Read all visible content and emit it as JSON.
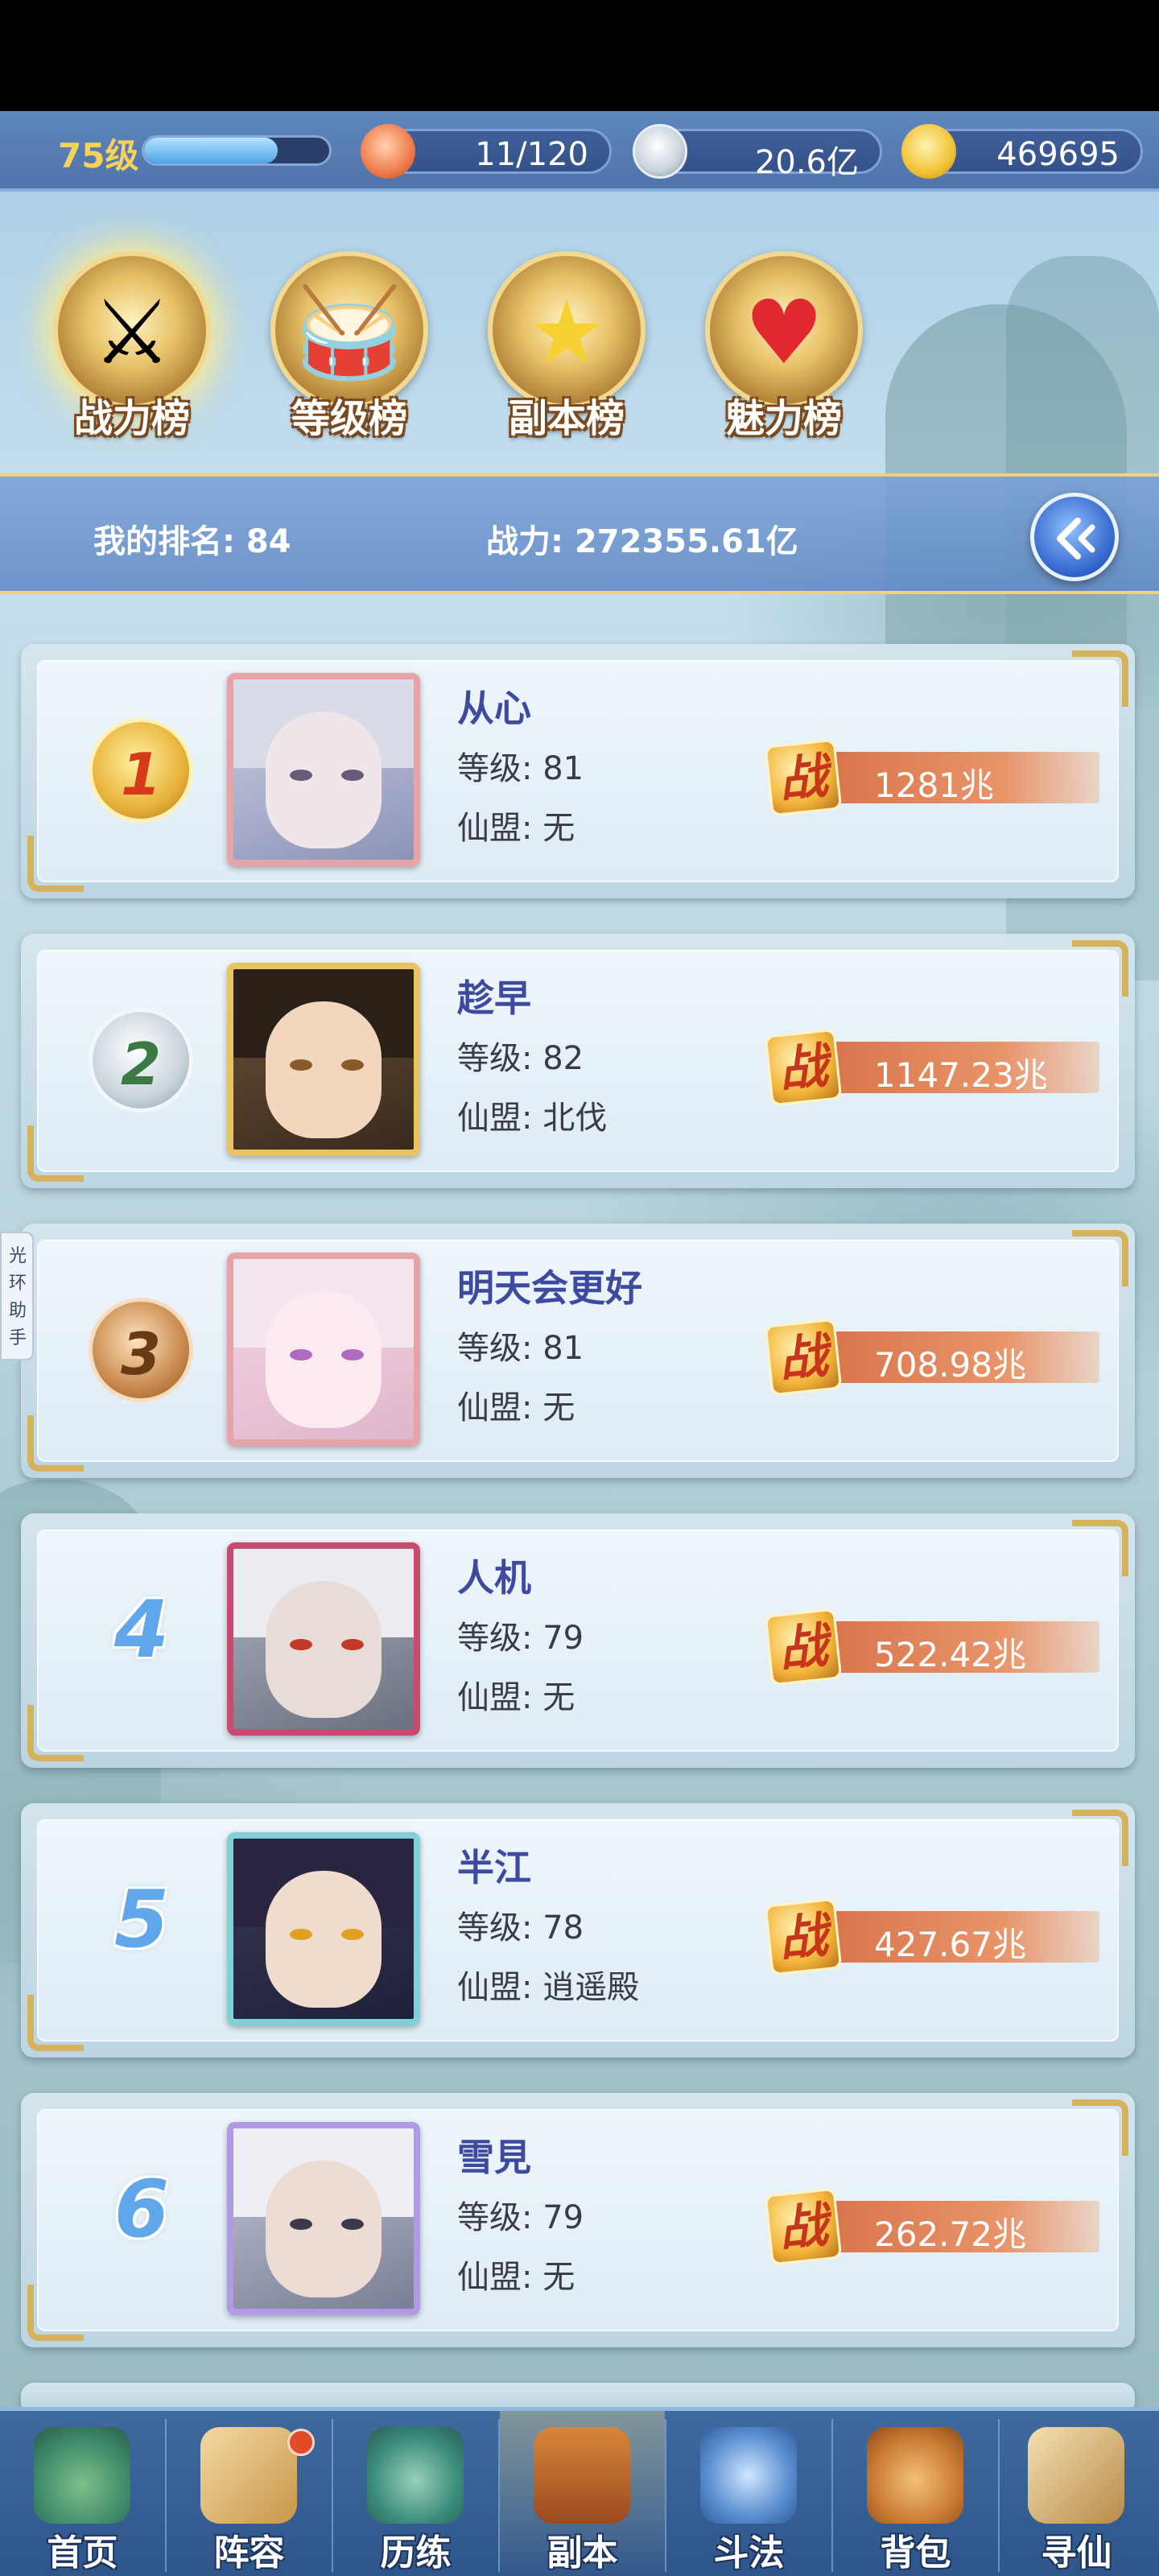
{
  "resources": {
    "level": "75级",
    "xp_fraction": 0.72,
    "stamina": "11/120",
    "silver": "20.6亿",
    "gold": "469695"
  },
  "tabs": [
    {
      "label": "战力榜",
      "icon": "sword-icon",
      "active": true
    },
    {
      "label": "等级榜",
      "icon": "drum-icon",
      "active": false
    },
    {
      "label": "副本榜",
      "icon": "star-icon",
      "active": false
    },
    {
      "label": "魅力榜",
      "icon": "heart-icon",
      "active": false
    }
  ],
  "my_rank": {
    "rank_text": "我的排名: 84",
    "power_text": "战力: 272355.61亿"
  },
  "assistant_label": "光环助手",
  "power_badge_glyph": "战",
  "rankings": [
    {
      "rank": "1",
      "name": "从心",
      "level": "等级: 81",
      "guild": "仙盟: 无",
      "power": "1281兆"
    },
    {
      "rank": "2",
      "name": "趁早",
      "level": "等级: 82",
      "guild": "仙盟: 北伐",
      "power": "1147.23兆"
    },
    {
      "rank": "3",
      "name": "明天会更好",
      "level": "等级: 81",
      "guild": "仙盟: 无",
      "power": "708.98兆"
    },
    {
      "rank": "4",
      "name": "人机",
      "level": "等级: 79",
      "guild": "仙盟: 无",
      "power": "522.42兆"
    },
    {
      "rank": "5",
      "name": "半江",
      "level": "等级: 78",
      "guild": "仙盟: 逍遥殿",
      "power": "427.67兆"
    },
    {
      "rank": "6",
      "name": "雪見",
      "level": "等级: 79",
      "guild": "仙盟: 无",
      "power": "262.72兆"
    }
  ],
  "bottom_nav": [
    {
      "label": "首页",
      "icon": "home-mountain-icon",
      "active": false
    },
    {
      "label": "阵容",
      "icon": "cards-icon",
      "active": false
    },
    {
      "label": "历练",
      "icon": "gourd-icon",
      "active": false
    },
    {
      "label": "副本",
      "icon": "gate-icon",
      "active": true
    },
    {
      "label": "斗法",
      "icon": "crossed-swords-icon",
      "active": false
    },
    {
      "label": "背包",
      "icon": "bag-icon",
      "active": false
    },
    {
      "label": "寻仙",
      "icon": "scroll-icon",
      "active": false
    }
  ],
  "colors": {
    "accent_gold": "#d6b25c",
    "power_bar": "#d9744c",
    "name_text": "#3e4aa0",
    "rank_number": "#5fa6ea"
  }
}
